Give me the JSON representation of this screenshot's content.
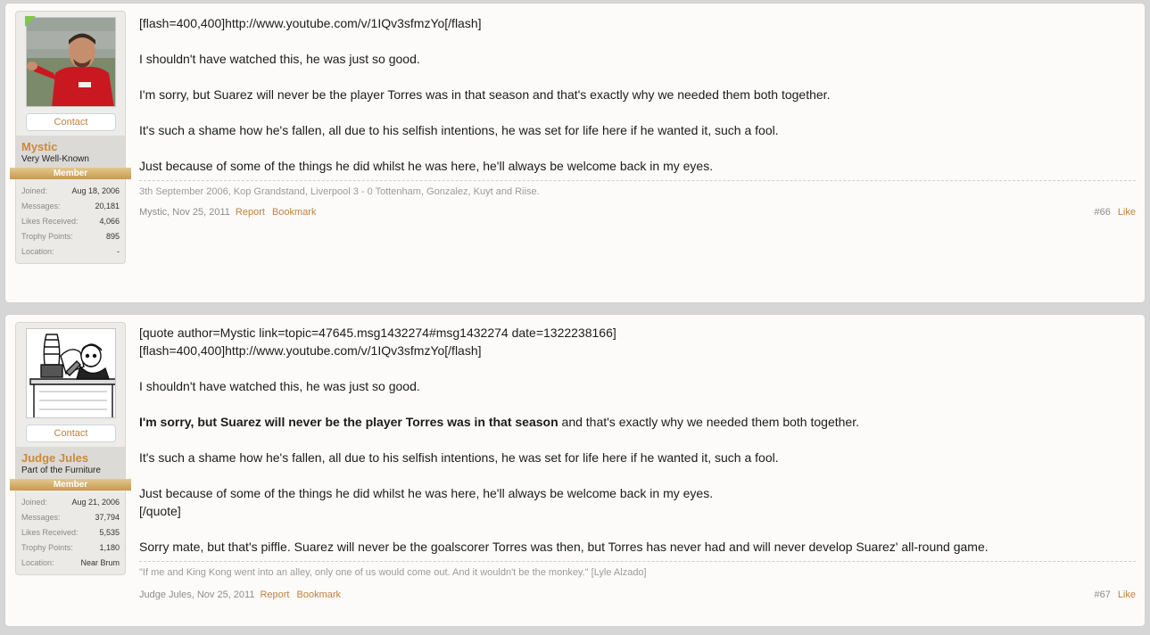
{
  "posts": [
    {
      "user": {
        "name": "Mystic",
        "title": "Very Well-Known",
        "banner": "Member",
        "contact": "Contact",
        "stats": [
          {
            "label": "Joined:",
            "value": "Aug 18, 2006"
          },
          {
            "label": "Messages:",
            "value": "20,181"
          },
          {
            "label": "Likes Received:",
            "value": "4,066"
          },
          {
            "label": "Trophy Points:",
            "value": "895"
          },
          {
            "label": "Location:",
            "value": "-"
          }
        ]
      },
      "message": {
        "lines": [
          "[flash=400,400]http://www.youtube.com/v/1IQv3sfmzYo[/flash]",
          "",
          "I shouldn't have watched this, he was just so good.",
          "",
          "I'm sorry, but Suarez will never be the player Torres was in that season and that's exactly why we needed them both together.",
          "",
          "It's such a shame how he's fallen, all due to his selfish intentions, he was set for life here if he wanted it, such a fool.",
          "",
          "Just because of some of the things he did whilst he was here, he'll always be welcome back in my eyes."
        ]
      },
      "signature": "3th September 2006, Kop Grandstand, Liverpool 3 - 0 Tottenham, Gonzalez, Kuyt and Riise.",
      "footer": {
        "author": "Mystic",
        "date": "Nov 25, 2011",
        "report": "Report",
        "bookmark": "Bookmark",
        "post_number": "#66",
        "like": "Like"
      }
    },
    {
      "user": {
        "name": "Judge Jules",
        "title": "Part of the Furniture",
        "banner": "Member",
        "contact": "Contact",
        "stats": [
          {
            "label": "Joined:",
            "value": "Aug 21, 2006"
          },
          {
            "label": "Messages:",
            "value": "37,794"
          },
          {
            "label": "Likes Received:",
            "value": "5,535"
          },
          {
            "label": "Trophy Points:",
            "value": "1,180"
          },
          {
            "label": "Location:",
            "value": "Near Brum"
          }
        ]
      },
      "message": {
        "lines": [
          "[quote author=Mystic link=topic=47645.msg1432274#msg1432274 date=1322238166]",
          "[flash=400,400]http://www.youtube.com/v/1IQv3sfmzYo[/flash]",
          "",
          "I shouldn't have watched this, he was just so good.",
          "",
          "",
          "",
          "It's such a shame how he's fallen, all due to his selfish intentions, he was set for life here if he wanted it, such a fool.",
          "",
          "Just because of some of the things he did whilst he was here, he'll always be welcome back in my eyes.",
          "[/quote]",
          "",
          "Sorry mate, but that's piffle. Suarez will never be the goalscorer Torres was then, but Torres has never had and will never develop Suarez' all-round game."
        ],
        "bold_part": "I'm sorry, but Suarez will never be the player Torres was in that season",
        "rest_part": " and that's exactly why we needed them both together."
      },
      "signature": "\"If me and King Kong went into an alley, only one of us would come out. And it wouldn't be the monkey.\"  [Lyle Alzado]",
      "footer": {
        "author": "Judge Jules",
        "date": "Nov 25, 2011",
        "report": "Report",
        "bookmark": "Bookmark",
        "post_number": "#67",
        "like": "Like"
      }
    }
  ]
}
